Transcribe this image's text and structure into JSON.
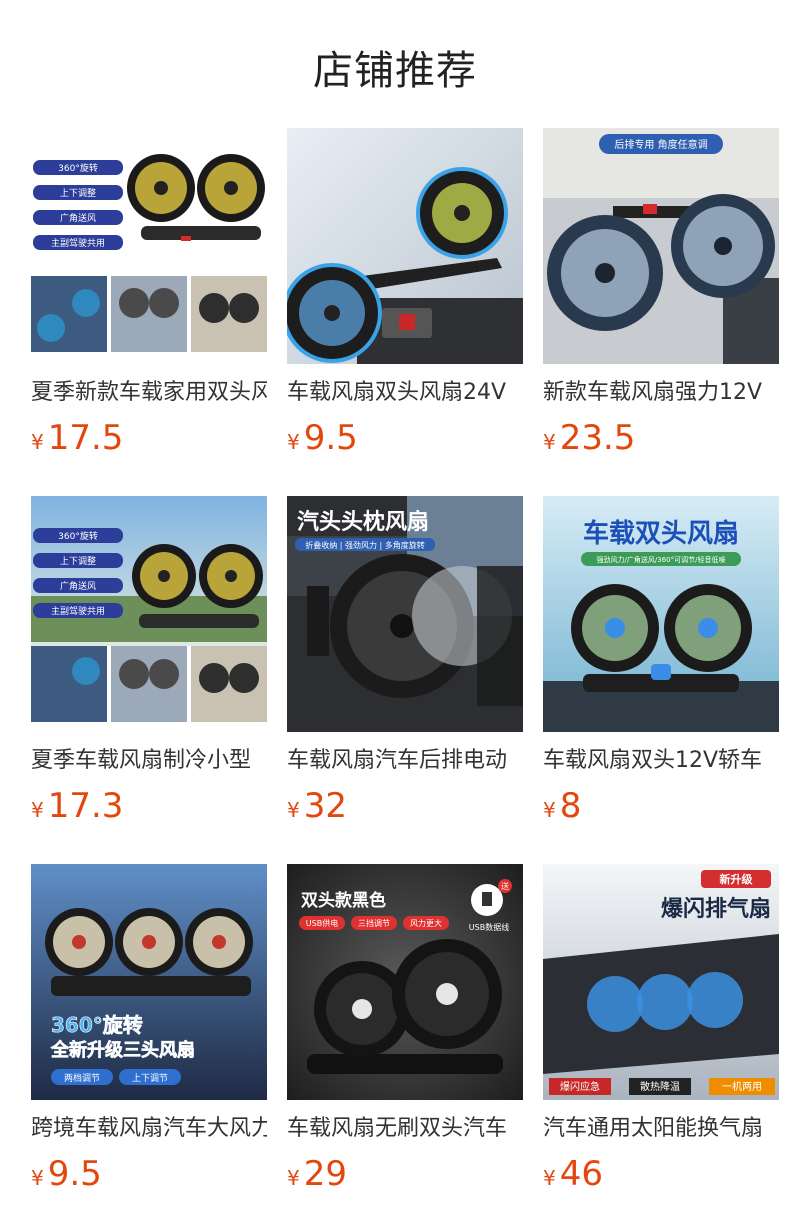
{
  "page_title": "店铺推荐",
  "currency_symbol": "¥",
  "products": [
    {
      "name": "夏季新款车载家用双头风扇",
      "price": "17.5",
      "tags": [
        "360°旋转",
        "上下调整",
        "广角送风",
        "主副驾驶共用"
      ]
    },
    {
      "name": "车载风扇双头风扇24V",
      "price": "9.5"
    },
    {
      "name": "新款车载风扇强力12V",
      "price": "23.5",
      "banner": "后排专用 角度任意调"
    },
    {
      "name": "夏季车载风扇制冷小型",
      "price": "17.3",
      "tags": [
        "360°旋转",
        "上下调整",
        "广角送风",
        "主副驾驶共用"
      ]
    },
    {
      "name": "车载风扇汽车后排电动",
      "price": "32",
      "headline": "汽头头枕风扇",
      "sub": "折叠收纳 | 强劲风力 | 多角度旋转"
    },
    {
      "name": "车载风扇双头12V轿车",
      "price": "8",
      "headline": "车载双头风扇",
      "sub": "强劲风力/广角送风/360°可调节/轻音低噪"
    },
    {
      "name": "跨境车载风扇汽车大风力",
      "price": "9.5",
      "headline1": "360°旋转",
      "headline2": "全新升级三头风扇",
      "chips": [
        "两档调节",
        "上下调节"
      ]
    },
    {
      "name": "车载风扇无刷双头汽车",
      "price": "29",
      "headline": "双头款黑色",
      "chips": [
        "USB供电",
        "三挡调节",
        "风力更大"
      ],
      "cable_label": "USB数据线",
      "badge": "送"
    },
    {
      "name": "汽车通用太阳能换气扇",
      "price": "46",
      "badge": "新升级",
      "headline": "爆闪排气扇",
      "chips": [
        "爆闪应急",
        "散热降温",
        "一机两用"
      ]
    }
  ]
}
